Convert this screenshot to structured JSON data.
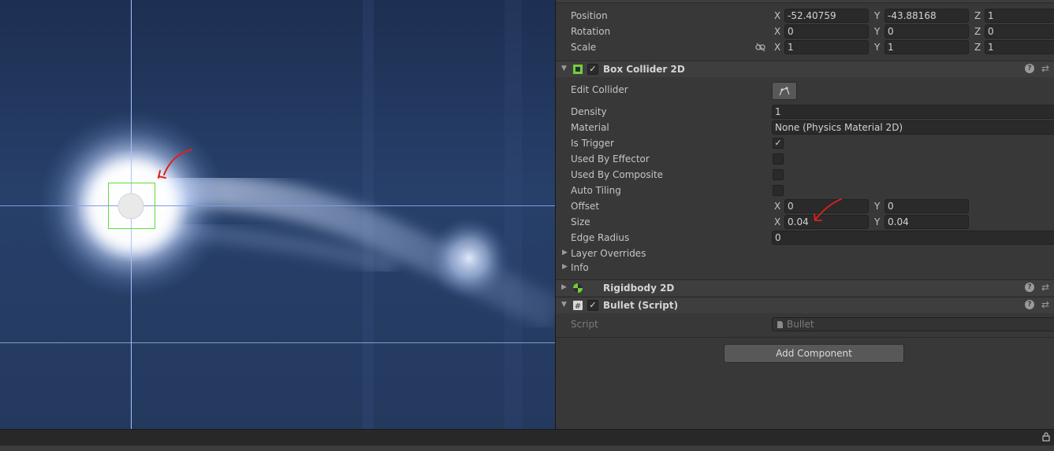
{
  "transform": {
    "position": {
      "label": "Position",
      "x": "-52.40759",
      "y": "-43.88168",
      "z": "1"
    },
    "rotation": {
      "label": "Rotation",
      "x": "0",
      "y": "0",
      "z": "0"
    },
    "scale": {
      "label": "Scale",
      "x": "1",
      "y": "1",
      "z": "1"
    },
    "axis_x": "X",
    "axis_y": "Y",
    "axis_z": "Z"
  },
  "box_collider": {
    "title": "Box Collider 2D",
    "edit_collider_label": "Edit Collider",
    "density_label": "Density",
    "density": "1",
    "material_label": "Material",
    "material": "None (Physics Material 2D)",
    "is_trigger_label": "Is Trigger",
    "is_trigger": "✓",
    "used_by_effector_label": "Used By Effector",
    "used_by_composite_label": "Used By Composite",
    "auto_tiling_label": "Auto Tiling",
    "offset_label": "Offset",
    "offset_x": "0",
    "offset_y": "0",
    "size_label": "Size",
    "size_x": "0.04",
    "size_y": "0.04",
    "edge_radius_label": "Edge Radius",
    "edge_radius": "0",
    "layer_overrides_label": "Layer Overrides",
    "info_label": "Info"
  },
  "rigidbody": {
    "title": "Rigidbody 2D"
  },
  "bullet_script": {
    "title": "Bullet (Script)",
    "script_label": "Script",
    "script_value": "Bullet"
  },
  "add_component_label": "Add Component",
  "icons": {
    "checkmark": "✓",
    "help": "?",
    "fold_open": "▼",
    "fold_closed": "▶",
    "settings": "⇄",
    "lock": "🔒"
  },
  "colors": {
    "annotation": "#e0201c",
    "collider_outline": "#5fdb3f",
    "scene_bg": "#24395e",
    "inspector_bg": "#383838"
  }
}
